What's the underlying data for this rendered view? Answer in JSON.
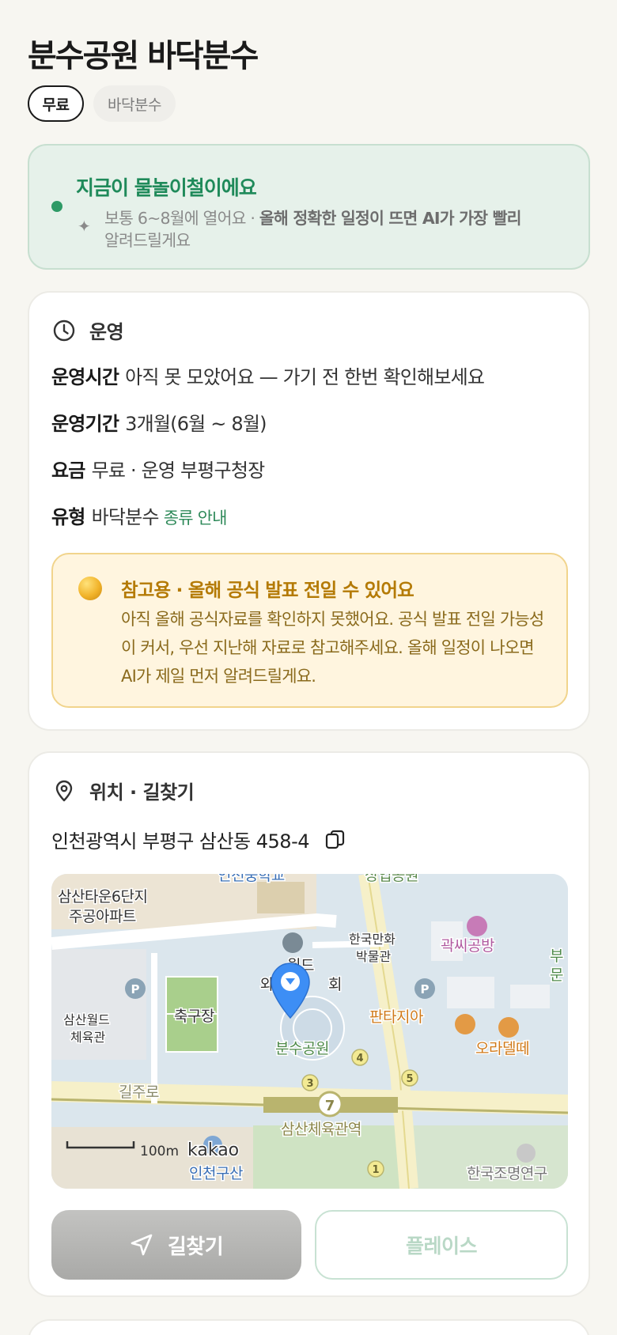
{
  "header": {
    "title": "분수공원 바닥분수"
  },
  "chips": {
    "price": "무료",
    "type": "바닥분수"
  },
  "season": {
    "title": "지금이 물놀이철이에요",
    "desc_plain": "보통 6~8월에 열어요 · ",
    "desc_bold": "올해 정확한 일정이 뜨면 AI가 가장 빨리",
    "desc_tail": "알려드릴게요"
  },
  "operation": {
    "heading": "운영",
    "rows": [
      {
        "label": "운영시간",
        "value": "아직 못 모았어요 — 가기 전 한번 확인해보세요"
      },
      {
        "label": "운영기간",
        "value": "3개월(6월 ~ 8월)"
      },
      {
        "label": "요금",
        "value": "무료 · 운영 부평구청장"
      },
      {
        "label": "유형",
        "value": "바닥분수",
        "link": "종류 안내"
      }
    ],
    "notice": {
      "title": "참고용 · 올해 공식 발표 전일 수 있어요",
      "body": "아직 올해 공식자료를 확인하지 못했어요. 공식 발표 전일 가능성이 커서, 우선 지난해 자료로 참고해주세요. 올해 일정이 나오면 AI가 제일 먼저 알려드릴게요."
    }
  },
  "location": {
    "heading": "위치 · 길찾기",
    "address": "인천광역시 부평구 삼산동 458-4",
    "map": {
      "labels": {
        "apt": "삼산타운6단지",
        "apt2": "주공아파트",
        "school": "인천중학교",
        "park": "상업공원",
        "worldcup": "월드",
        "worldcup2": "와이",
        "hall": "회",
        "museum": "한국만화",
        "museum2": "박물관",
        "studio": "곽씨공방",
        "bu": "부",
        "mun": "문",
        "gym": "삼산월드",
        "gym2": "체육관",
        "soccer": "축구장",
        "fountain": "분수공원",
        "fantasia": "판타지아",
        "oradelle": "오라델떼",
        "road": "길주로",
        "station": "삼산체육관역",
        "lighting": "한국조명연구",
        "scale": "100m",
        "brand": "kakao",
        "incheon": "인천구산",
        "line_no": "7",
        "exit1": "1",
        "exit3": "3",
        "exit4": "4",
        "exit5": "5",
        "parking": "P"
      }
    },
    "buttons": {
      "directions": "길찾기",
      "place": "플레이스"
    }
  },
  "colors": {
    "accent_green": "#1f8a5a",
    "notice_gold": "#b47a05",
    "pin_blue": "#3d8ef5"
  }
}
